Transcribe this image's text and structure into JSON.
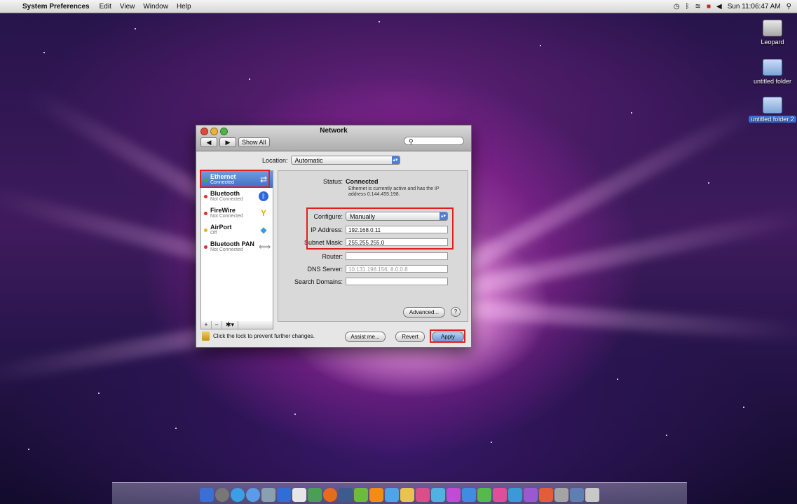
{
  "menubar": {
    "app_name": "System Preferences",
    "items": [
      "Edit",
      "View",
      "Window",
      "Help"
    ],
    "clock": "Sun 11:06:47 AM"
  },
  "desktop_icons": [
    {
      "label": "Leopard",
      "icon": "disk-icon"
    },
    {
      "label": "untitled folder",
      "icon": "folder-icon"
    },
    {
      "label": "untitled folder 2",
      "icon": "folder-icon",
      "selected": true
    }
  ],
  "window": {
    "title": "Network",
    "show_all": "Show All",
    "location_label": "Location:",
    "location_value": "Automatic",
    "services": [
      {
        "name": "Ethernet",
        "sub": "Connected",
        "dot": "#3cb043",
        "icon": "ethernet-icon",
        "selected": true
      },
      {
        "name": "Bluetooth",
        "sub": "Not Connected",
        "dot": "#d93030",
        "icon": "bluetooth-icon"
      },
      {
        "name": "FireWire",
        "sub": "Not Connected",
        "dot": "#d93030",
        "icon": "firewire-icon"
      },
      {
        "name": "AirPort",
        "sub": "Off",
        "dot": "#e3b52a",
        "icon": "airport-icon"
      },
      {
        "name": "Bluetooth PAN",
        "sub": "Not Connected",
        "dot": "#d93030",
        "icon": "bluetooth-pan-icon"
      }
    ],
    "status_label": "Status:",
    "status_value": "Connected",
    "status_desc": "Ethernet is currently active and has the IP address 0.144.455.198.",
    "configure_label": "Configure:",
    "configure_value": "Manually",
    "ip_label": "IP Address:",
    "ip_value": "192.168.0.11",
    "subnet_label": "Subnet Mask:",
    "subnet_value": "255.255.255.0",
    "router_label": "Router:",
    "router_value": "",
    "dns_label": "DNS Server:",
    "dns_value": "10.131.198.156, 8.0.0.8",
    "search_domains_label": "Search Domains:",
    "search_domains_value": "",
    "advanced_button": "Advanced...",
    "help_button": "?",
    "lock_text": "Click the lock to prevent further changes.",
    "assist_button": "Assist me...",
    "revert_button": "Revert",
    "apply_button": "Apply",
    "sidebar_foot": [
      "+",
      "−",
      "✱▾"
    ]
  },
  "accent_colors": {
    "highlight": "#e02020",
    "selection": "#3f6fc4"
  }
}
